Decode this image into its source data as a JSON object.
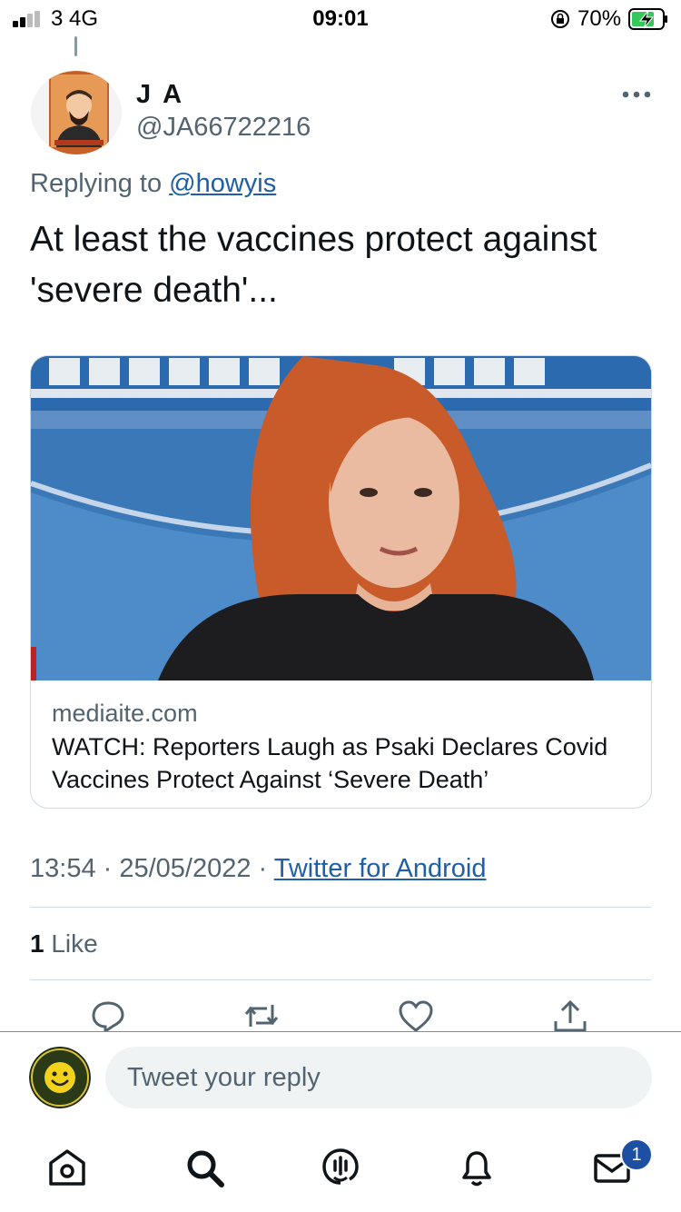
{
  "status_bar": {
    "carrier": "3  4G",
    "time": "09:01",
    "battery_percent": "70%",
    "signal_bars_filled": 2,
    "battery_level": 0.7
  },
  "tweet": {
    "author_name": "J A",
    "author_handle": "@JA66722216",
    "replying_to_prefix": "Replying to ",
    "replying_to_handle": "@howyis",
    "text": "At least the vaccines protect against 'severe death'...",
    "avatar_icon": "author-portrait-avatar",
    "timestamp": "13:54 · 25/05/2022 · ",
    "source": "Twitter for Android",
    "likes_count": "1",
    "likes_label": " Like"
  },
  "link_card": {
    "image_icon": "press-briefing-photo",
    "domain": "mediaite.com",
    "title": "WATCH: Reporters Laugh as Psaki Declares Covid Vaccines Protect Against ‘Severe Death’"
  },
  "actions": [
    "reply-icon",
    "retweet-icon",
    "like-icon",
    "share-icon"
  ],
  "reply_bar": {
    "placeholder": "Tweet your reply",
    "avatar_icon": "smiley-badge-avatar"
  },
  "bottom_nav": {
    "items": [
      "home-icon",
      "search-icon",
      "spaces-icon",
      "notifications-icon",
      "messages-icon"
    ],
    "messages_badge": "1"
  },
  "colors": {
    "link": "#1d5fa8",
    "secondary_text": "#536471",
    "divider": "#cfd9de",
    "badge": "#1d4fa3"
  }
}
